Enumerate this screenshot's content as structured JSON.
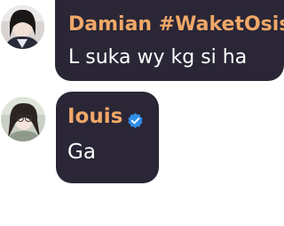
{
  "messages": [
    {
      "author": "Damian #WaketOsis",
      "author_color": "#f0a868",
      "text": "L suka wy kg si ha",
      "avatar_icon": "avatar-photo-icon",
      "verified": false
    },
    {
      "author": "Iouis",
      "author_color": "#f0a868",
      "text": "Ga",
      "avatar_icon": "avatar-photo-icon",
      "verified": true,
      "badge_icon": "verified-badge-icon",
      "badge_color": "#2f8fe8"
    }
  ],
  "colors": {
    "bubble": "#2a2636",
    "background": "#ffffff"
  }
}
